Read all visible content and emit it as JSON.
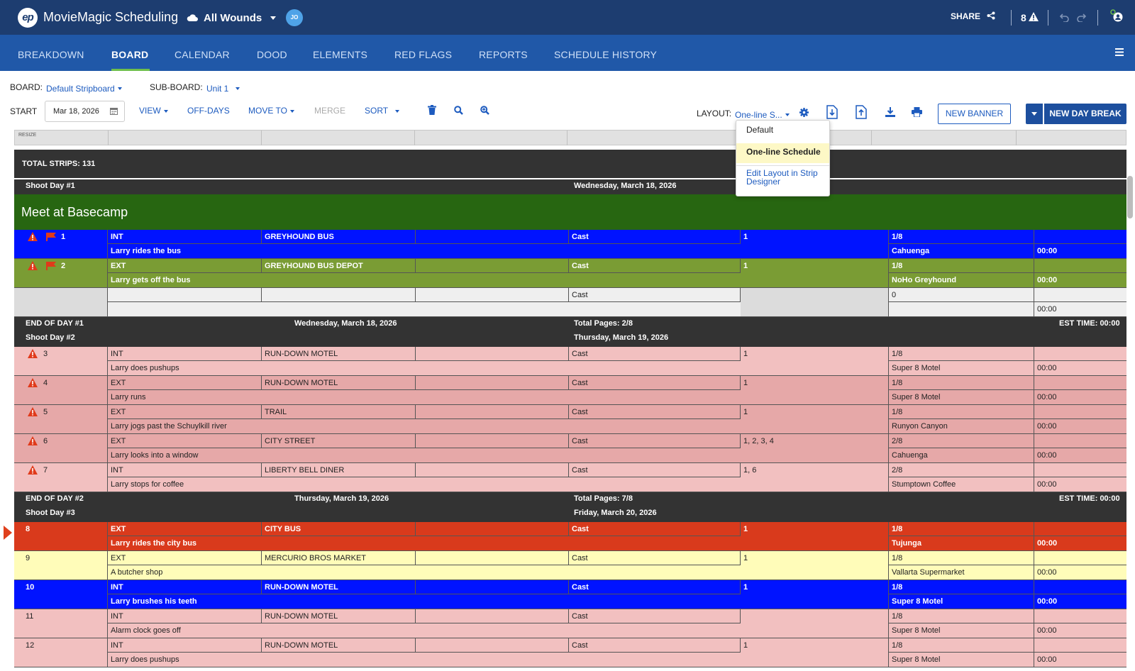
{
  "app": {
    "logo_text": "ep",
    "title": "MovieMagic Scheduling",
    "project_name": "All Wounds",
    "avatar_initials": "JO",
    "share_label": "SHARE",
    "red_flag_count": "8"
  },
  "nav": {
    "tabs": [
      {
        "label": "BREAKDOWN"
      },
      {
        "label": "BOARD",
        "active": true
      },
      {
        "label": "CALENDAR"
      },
      {
        "label": "DOOD"
      },
      {
        "label": "ELEMENTS"
      },
      {
        "label": "RED FLAGS"
      },
      {
        "label": "REPORTS"
      },
      {
        "label": "SCHEDULE HISTORY"
      }
    ]
  },
  "board_bar": {
    "board_label": "BOARD:",
    "board_value": "Default Stripboard",
    "subboard_label": "SUB-BOARD:",
    "subboard_value": "Unit 1"
  },
  "toolbar": {
    "start_label": "START",
    "start_date": "Mar 18, 2026",
    "view": "VIEW",
    "off_days": "OFF-DAYS",
    "move_to": "MOVE TO",
    "merge": "MERGE",
    "sort": "SORT",
    "layout_label": "LAYOUT:",
    "layout_value": "One-line S...",
    "new_banner": "NEW BANNER",
    "new_day_break": "NEW DAY BREAK"
  },
  "layout_menu": {
    "items": [
      {
        "label": "Default"
      },
      {
        "label": "One-line Schedule",
        "selected": true
      },
      {
        "label": "Edit Layout in Strip Designer"
      }
    ]
  },
  "board": {
    "resize_label": "RESIZE",
    "total_strips": "TOTAL STRIPS: 131",
    "banner": "Meet at Basecamp",
    "days": [
      {
        "shoot_day": "Shoot Day #1",
        "date": "Wednesday, March 18, 2026",
        "end_label": "END OF DAY #1",
        "total_pages": "Total Pages: 2/8",
        "est_time": "EST TIME: 00:00"
      },
      {
        "shoot_day": "Shoot Day #2",
        "date": "Thursday, March 19, 2026",
        "end_label": "END OF DAY #2",
        "total_pages": "Total Pages: 7/8",
        "est_time": "EST TIME: 00:00"
      },
      {
        "shoot_day": "Shoot Day #3",
        "date": "Friday, March 20, 2026"
      }
    ],
    "strips": [
      {
        "num": "1",
        "ie": "INT",
        "set": "GREYHOUND BUS",
        "cast": "Cast",
        "cast_ids": "1",
        "pages": "1/8",
        "desc": "Larry rides the bus",
        "location": "Cahuenga",
        "time": "00:00"
      },
      {
        "num": "2",
        "ie": "EXT",
        "set": "GREYHOUND BUS DEPOT",
        "cast": "Cast",
        "cast_ids": "1",
        "pages": "1/8",
        "desc": "Larry gets off the bus",
        "location": "NoHo Greyhound",
        "time": "00:00"
      },
      {
        "num": "",
        "ie": "",
        "set": "",
        "cast": "Cast",
        "cast_ids": "",
        "pages": "0",
        "desc": "",
        "location": "",
        "time": "00:00"
      },
      {
        "num": "3",
        "ie": "INT",
        "set": "RUN-DOWN MOTEL",
        "cast": "Cast",
        "cast_ids": "1",
        "pages": "1/8",
        "desc": "Larry does pushups",
        "location": "Super 8 Motel",
        "time": "00:00"
      },
      {
        "num": "4",
        "ie": "EXT",
        "set": "RUN-DOWN MOTEL",
        "cast": "Cast",
        "cast_ids": "1",
        "pages": "1/8",
        "desc": "Larry runs",
        "location": "Super 8 Motel",
        "time": "00:00"
      },
      {
        "num": "5",
        "ie": "EXT",
        "set": "TRAIL",
        "cast": "Cast",
        "cast_ids": "1",
        "pages": "1/8",
        "desc": "Larry jogs past the Schuylkill river",
        "location": "Runyon Canyon",
        "time": "00:00"
      },
      {
        "num": "6",
        "ie": "EXT",
        "set": "CITY STREET",
        "cast": "Cast",
        "cast_ids": "1, 2, 3, 4",
        "pages": "2/8",
        "desc": "Larry looks into a window",
        "location": "Cahuenga",
        "time": "00:00"
      },
      {
        "num": "7",
        "ie": "INT",
        "set": "LIBERTY BELL DINER",
        "cast": "Cast",
        "cast_ids": "1, 6",
        "pages": "2/8",
        "desc": "Larry stops for coffee",
        "location": "Stumptown Coffee",
        "time": "00:00"
      },
      {
        "num": "8",
        "ie": "EXT",
        "set": "CITY BUS",
        "cast": "Cast",
        "cast_ids": "1",
        "pages": "1/8",
        "desc": "Larry rides the city bus",
        "location": "Tujunga",
        "time": "00:00"
      },
      {
        "num": "9",
        "ie": "EXT",
        "set": "MERCURIO BROS MARKET",
        "cast": "Cast",
        "cast_ids": "1",
        "pages": "1/8",
        "desc": "A butcher shop",
        "location": "Vallarta Supermarket",
        "time": "00:00"
      },
      {
        "num": "10",
        "ie": "INT",
        "set": "RUN-DOWN MOTEL",
        "cast": "Cast",
        "cast_ids": "1",
        "pages": "1/8",
        "desc": "Larry brushes his teeth",
        "location": "Super 8 Motel",
        "time": "00:00"
      },
      {
        "num": "11",
        "ie": "INT",
        "set": "RUN-DOWN MOTEL",
        "cast": "Cast",
        "cast_ids": "",
        "pages": "1/8",
        "desc": "Alarm clock goes off",
        "location": "Super 8 Motel",
        "time": "00:00"
      },
      {
        "num": "12",
        "ie": "INT",
        "set": "RUN-DOWN MOTEL",
        "cast": "Cast",
        "cast_ids": "1",
        "pages": "1/8",
        "desc": "Larry does pushups",
        "location": "Super 8 Motel",
        "time": "00:00"
      }
    ]
  },
  "colors": {
    "topbar": "#1d3d70",
    "navbar": "#2058a8",
    "accent_green": "#6fbf4c",
    "banner_green": "#276611",
    "strip_blue": "#0013ff",
    "strip_green": "#7a9c34",
    "strip_pink": "#f2c0c0",
    "strip_red": "#d93a1c",
    "strip_yellow": "#fffcb9",
    "warning_red": "#e03a1a"
  }
}
